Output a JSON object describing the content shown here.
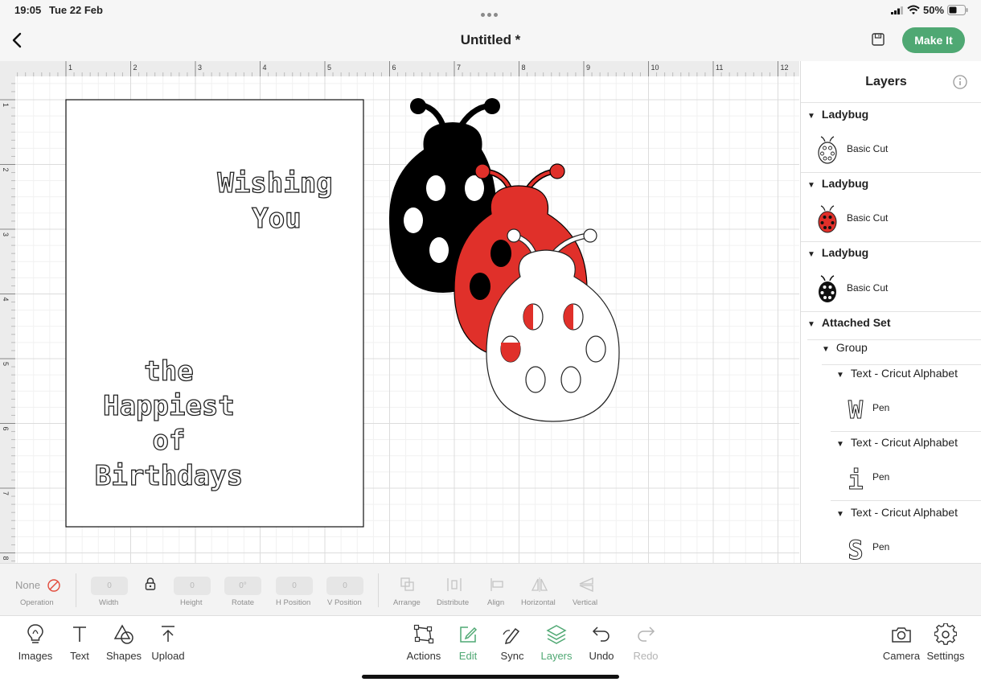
{
  "status_bar": {
    "time": "19:05",
    "date": "Tue 22 Feb",
    "battery": "50%"
  },
  "header": {
    "title": "Untitled *",
    "make_it_label": "Make It"
  },
  "canvas": {
    "ruler_x": [
      "1",
      "2",
      "3",
      "4",
      "5",
      "6",
      "7",
      "8",
      "9",
      "10",
      "11",
      "12"
    ],
    "ruler_y": [
      "1",
      "2",
      "3",
      "4",
      "5",
      "6",
      "7",
      "8"
    ],
    "card_text": [
      "Wishing",
      "You",
      "the",
      "Happiest",
      "of",
      "Birthdays"
    ]
  },
  "layers_panel": {
    "title": "Layers",
    "groups": [
      {
        "name": "Ladybug",
        "operation": "Basic Cut",
        "thumb": "ladybug-white-thumbnail"
      },
      {
        "name": "Ladybug",
        "operation": "Basic Cut",
        "thumb": "ladybug-red-thumbnail"
      },
      {
        "name": "Ladybug",
        "operation": "Basic Cut",
        "thumb": "ladybug-black-thumbnail"
      }
    ],
    "attached_set": "Attached Set",
    "group_label": "Group",
    "text_layers": [
      {
        "name": "Text - Cricut Alphabet",
        "operation": "Pen",
        "glyph": "W"
      },
      {
        "name": "Text - Cricut Alphabet",
        "operation": "Pen",
        "glyph": "i"
      },
      {
        "name": "Text - Cricut Alphabet",
        "operation": "Pen",
        "glyph": "S"
      }
    ]
  },
  "edit_bar": {
    "operation_value": "None",
    "operation_label": "Operation",
    "width_value": "0",
    "width_label": "Width",
    "height_value": "0",
    "height_label": "Height",
    "rotate_value": "0°",
    "rotate_label": "Rotate",
    "hpos_value": "0",
    "hpos_label": "H Position",
    "vpos_value": "0",
    "vpos_label": "V Position",
    "arrange_label": "Arrange",
    "distribute_label": "Distribute",
    "align_label": "Align",
    "horizontal_label": "Horizontal",
    "vertical_label": "Vertical"
  },
  "toolbar": {
    "images": "Images",
    "text": "Text",
    "shapes": "Shapes",
    "upload": "Upload",
    "actions": "Actions",
    "edit": "Edit",
    "sync": "Sync",
    "layers": "Layers",
    "undo": "Undo",
    "redo": "Redo",
    "camera": "Camera",
    "settings": "Settings"
  },
  "colors": {
    "accent": "#4fa873",
    "ladybug_red": "#e0302a",
    "ladybug_black": "#000000"
  }
}
